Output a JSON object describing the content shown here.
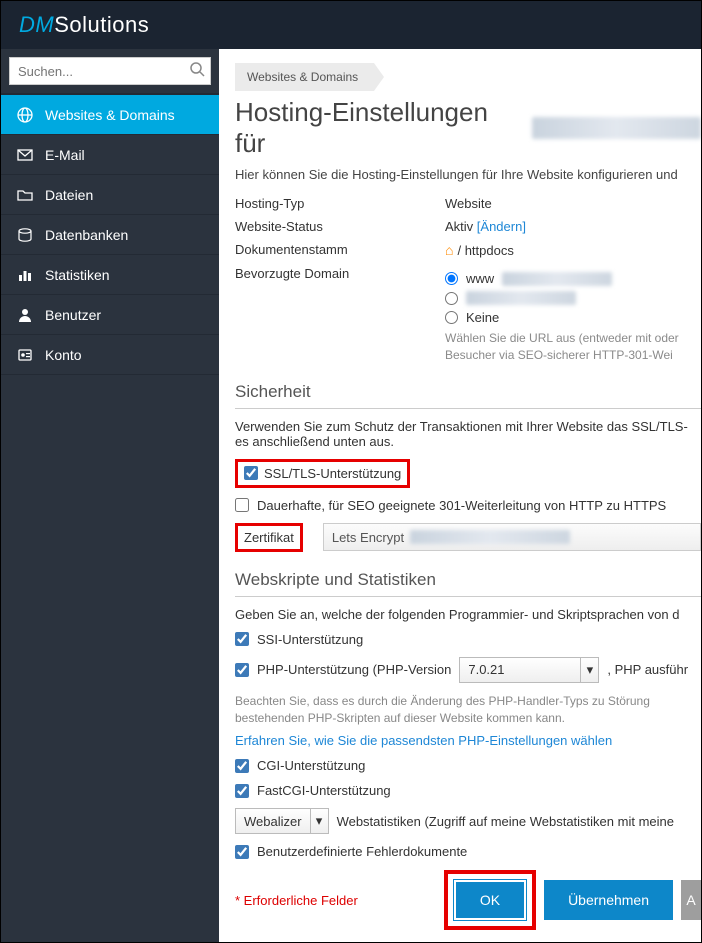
{
  "logo": {
    "dm": "DM",
    "sol": "Solutions"
  },
  "search": {
    "placeholder": "Suchen..."
  },
  "sidebar": {
    "items": [
      {
        "label": "Websites & Domains",
        "icon": "globe",
        "active": true
      },
      {
        "label": "E-Mail",
        "icon": "mail"
      },
      {
        "label": "Dateien",
        "icon": "folder"
      },
      {
        "label": "Datenbanken",
        "icon": "database"
      },
      {
        "label": "Statistiken",
        "icon": "stats"
      },
      {
        "label": "Benutzer",
        "icon": "user"
      },
      {
        "label": "Konto",
        "icon": "account"
      }
    ]
  },
  "breadcrumb": "Websites & Domains",
  "page_title": "Hosting-Einstellungen für ",
  "intro": "Hier können Sie die Hosting-Einstellungen für Ihre Website konfigurieren und",
  "kv": {
    "hosting_type": {
      "k": "Hosting-Typ",
      "v": "Website"
    },
    "status": {
      "k": "Website-Status",
      "v": "Aktiv",
      "change": "[Ändern]"
    },
    "docroot": {
      "k": "Dokumentenstamm",
      "v": "/ httpdocs"
    },
    "pref_domain": {
      "k": "Bevorzugte Domain",
      "www": "www",
      "none": "Keine",
      "note": "Wählen Sie die URL aus (entweder mit oder Besucher via SEO-sicherer HTTP-301-Wei"
    }
  },
  "sec_security": "Sicherheit",
  "sec_security_desc": "Verwenden Sie zum Schutz der Transaktionen mit Ihrer Website das SSL/TLS-es anschließend unten aus.",
  "ssl_label": "SSL/TLS-Unterstützung",
  "seo301_label": "Dauerhafte, für SEO geeignete 301-Weiterleitung von HTTP zu HTTPS",
  "cert_label": "Zertifikat",
  "cert_value": "Lets Encrypt",
  "sec_scripts": "Webskripte und Statistiken",
  "sec_scripts_desc": "Geben Sie an, welche der folgenden Programmier- und Skriptsprachen von d",
  "ssi": "SSI-Unterstützung",
  "php": "PHP-Unterstützung (PHP-Version",
  "php_ver": "7.0.21",
  "php_after": ", PHP ausführ",
  "php_note": "Beachten Sie, dass es durch die Änderung des PHP-Handler-Typs zu Störung bestehenden PHP-Skripten auf dieser Website kommen kann.",
  "php_link": "Erfahren Sie, wie Sie die passendsten PHP-Einstellungen wählen",
  "cgi": "CGI-Unterstützung",
  "fastcgi": "FastCGI-Unterstützung",
  "webstats_sel": "Webalizer",
  "webstats_after": "Webstatistiken (Zugriff auf meine Webstatistiken mit meine",
  "errdocs": "Benutzerdefinierte Fehlerdokumente",
  "required": "Erforderliche Felder",
  "ok": "OK",
  "apply": "Übernehmen",
  "cancel": "A"
}
